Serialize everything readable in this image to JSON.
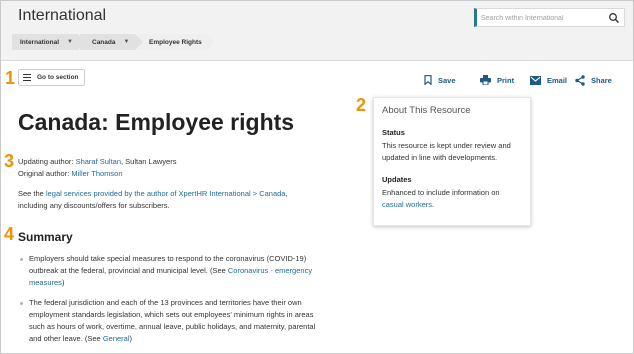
{
  "header": {
    "site_title": "International",
    "search_placeholder": "Search within International"
  },
  "breadcrumb": [
    {
      "label": "International"
    },
    {
      "label": "Canada"
    },
    {
      "label": "Employee Rights"
    }
  ],
  "annotations": [
    "1",
    "2",
    "3",
    "4"
  ],
  "toolbar": {
    "goto_label": "Go to section",
    "save_label": "Save",
    "print_label": "Print",
    "email_label": "Email",
    "share_label": "Share"
  },
  "page": {
    "title": "Canada: Employee rights",
    "updating_author_label": "Updating author:",
    "updating_author_name": "Sharaf Sultan",
    "updating_author_firm": ", Sultan Lawyers",
    "original_author_label": "Original author:",
    "original_author_name": "Miller Thomson",
    "see_prefix": "See the ",
    "see_link": "legal services provided by the author of XpertHR International > Canada",
    "see_suffix": ",",
    "see_line2": "including any discounts/offers for subscribers.",
    "summary_heading": "Summary",
    "bullets": [
      {
        "text_a": "Employers should take special measures to respond to the coronavirus (COVID-19)",
        "text_b": "outbreak at the federal, provincial and municipal level. (See ",
        "link_a": "Coronavirus - emergency",
        "link_b": "measures",
        "text_c": ")"
      },
      {
        "line1": "The federal jurisdiction and each of the 13 provinces and territories have their own",
        "line2": "employment standards legislation, which sets out employees' minimum rights in areas",
        "line3": "such as hours of work, overtime, annual leave, public holidays, and maternity, parental",
        "line4_prefix": "and other leave. (See ",
        "link": "General",
        "line4_suffix": ")"
      }
    ]
  },
  "about": {
    "heading": "About This Resource",
    "status_label": "Status",
    "status_line1": "This resource is kept under review and",
    "status_line2": "updated in line with developments.",
    "updates_label": "Updates",
    "updates_line1": "Enhanced to include information on",
    "updates_link": "casual workers",
    "updates_suffix": "."
  },
  "colors": {
    "accent_orange": "#f39200",
    "link_blue": "#1e6b9a",
    "action_blue": "#1d5a86",
    "search_accent": "#2a7a8c"
  }
}
